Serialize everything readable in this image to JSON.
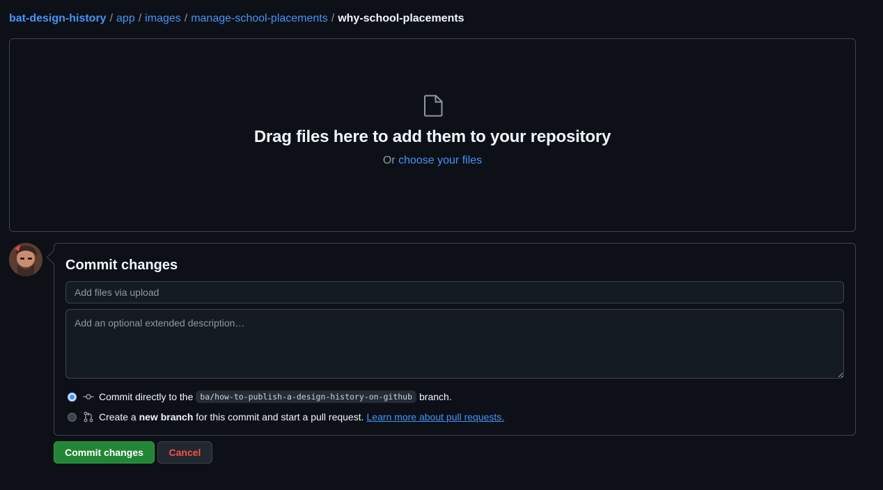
{
  "breadcrumb": {
    "repo": "bat-design-history",
    "segments": [
      "app",
      "images",
      "manage-school-placements"
    ],
    "current": "why-school-placements",
    "separator": "/"
  },
  "dropzone": {
    "icon": "file-icon",
    "title": "Drag files here to add them to your repository",
    "prefix": "Or",
    "choose_link": "choose your files"
  },
  "commit": {
    "title": "Commit changes",
    "summary_placeholder": "Add files via upload",
    "description_placeholder": "Add an optional extended description…",
    "option_direct": {
      "selected": true,
      "icon": "git-commit-icon",
      "prefix": "Commit directly to the",
      "branch": "ba/how-to-publish-a-design-history-on-github",
      "suffix": "branch."
    },
    "option_new": {
      "selected": false,
      "icon": "git-pull-request-icon",
      "prefix": "Create a",
      "bold": "new branch",
      "suffix": "for this commit and start a pull request.",
      "link": "Learn more about pull requests."
    }
  },
  "buttons": {
    "commit": "Commit changes",
    "cancel": "Cancel"
  },
  "colors": {
    "background": "#0d1117",
    "link": "#4493f8",
    "primary_button": "#238636",
    "danger_text": "#f85149",
    "border": "#3d444d"
  }
}
